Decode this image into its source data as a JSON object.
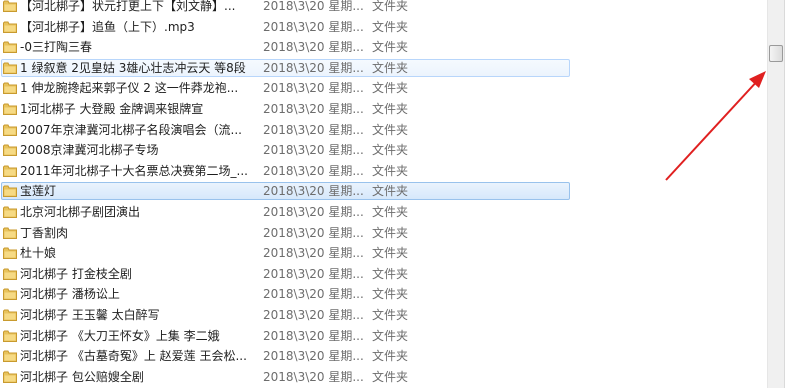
{
  "file_list": {
    "rows": [
      {
        "name": "【河北梆子】状元打更上下【刘文静】...",
        "date": "2018\\3\\20 星期...",
        "type": "文件夹",
        "state": ""
      },
      {
        "name": "【河北梆子】追鱼（上下）.mp3",
        "date": "2018\\3\\20 星期...",
        "type": "文件夹",
        "state": ""
      },
      {
        "name": "-0三打陶三春",
        "date": "2018\\3\\20 星期...",
        "type": "文件夹",
        "state": ""
      },
      {
        "name": "1 绿叙意 2见皇姑 3雄心壮志冲云天 等8段",
        "date": "2018\\3\\20 星期...",
        "type": "文件夹",
        "state": "hovered"
      },
      {
        "name": "1 伸龙腕搀起来郭子仪 2 这一件莽龙袍...",
        "date": "2018\\3\\20 星期...",
        "type": "文件夹",
        "state": ""
      },
      {
        "name": "1河北梆子 大登殿 金牌调来银牌宣",
        "date": "2018\\3\\20 星期...",
        "type": "文件夹",
        "state": ""
      },
      {
        "name": "2007年京津冀河北梆子名段演唱会（流...",
        "date": "2018\\3\\20 星期...",
        "type": "文件夹",
        "state": ""
      },
      {
        "name": "2008京津冀河北梆子专场",
        "date": "2018\\3\\20 星期...",
        "type": "文件夹",
        "state": ""
      },
      {
        "name": "2011年河北梆子十大名票总决赛第二场_...",
        "date": "2018\\3\\20 星期...",
        "type": "文件夹",
        "state": ""
      },
      {
        "name": "宝莲灯",
        "date": "2018\\3\\20 星期...",
        "type": "文件夹",
        "state": "selected"
      },
      {
        "name": "北京河北梆子剧团演出",
        "date": "2018\\3\\20 星期...",
        "type": "文件夹",
        "state": ""
      },
      {
        "name": "丁香割肉",
        "date": "2018\\3\\20 星期...",
        "type": "文件夹",
        "state": ""
      },
      {
        "name": "杜十娘",
        "date": "2018\\3\\20 星期...",
        "type": "文件夹",
        "state": ""
      },
      {
        "name": "河北梆子  打金枝全剧",
        "date": "2018\\3\\20 星期...",
        "type": "文件夹",
        "state": ""
      },
      {
        "name": "河北梆子  潘杨讼上",
        "date": "2018\\3\\20 星期...",
        "type": "文件夹",
        "state": ""
      },
      {
        "name": "河北梆子  王玉馨    太白醉写",
        "date": "2018\\3\\20 星期...",
        "type": "文件夹",
        "state": ""
      },
      {
        "name": "河北梆子  《大刀王怀女》上集  李二娥",
        "date": "2018\\3\\20 星期...",
        "type": "文件夹",
        "state": ""
      },
      {
        "name": "河北梆子 《古墓奇冤》上 赵爱莲 王会松...",
        "date": "2018\\3\\20 星期...",
        "type": "文件夹",
        "state": ""
      },
      {
        "name": "河北梆子 包公赔嫂全剧",
        "date": "2018\\3\\20 星期...",
        "type": "文件夹",
        "state": ""
      }
    ]
  },
  "scrollbar": {
    "thumb_position_fraction": 0.12
  },
  "colors": {
    "folder": "#e8c35c",
    "selection_border": "#99c2ec",
    "selection_fill": "#d6e8fb",
    "secondary_text": "#6d6d6d",
    "annotation_arrow": "#e02020"
  },
  "icons": {
    "row_icon": "folder-icon"
  }
}
